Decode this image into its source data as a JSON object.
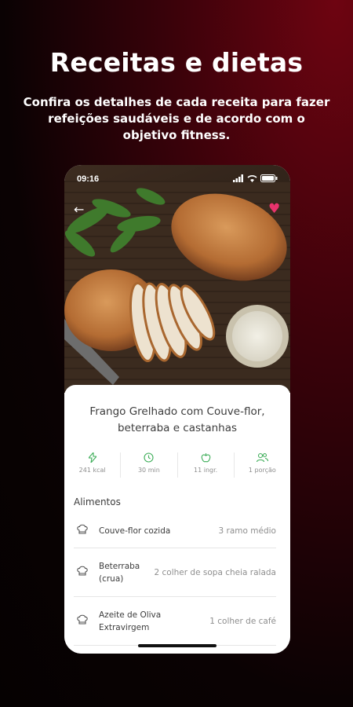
{
  "hero": {
    "title": "Receitas e dietas",
    "subtitle": "Confira os detalhes de cada receita para fazer refeições saudáveis e de acordo com o objetivo fitness."
  },
  "status_bar": {
    "time": "09:16",
    "icons": [
      "location-arrow-icon",
      "signal-icon",
      "wifi-icon",
      "battery-icon"
    ]
  },
  "recipe": {
    "title": "Frango Grelhado com Couve-flor, beterraba e castanhas",
    "stats": [
      {
        "icon": "lightning-icon",
        "value": "241 kcal"
      },
      {
        "icon": "clock-icon",
        "value": "30 min"
      },
      {
        "icon": "apple-icon",
        "value": "11 ingr."
      },
      {
        "icon": "people-icon",
        "value": "1 porção"
      }
    ],
    "section_title": "Alimentos",
    "foods": [
      {
        "name": "Couve-flor cozida",
        "quantity": "3 ramo médio"
      },
      {
        "name": "Beterraba (crua)",
        "quantity": "2 colher de sopa cheia ralada"
      },
      {
        "name": "Azeite de Oliva Extravirgem",
        "quantity": "1 colher de café"
      }
    ]
  },
  "colors": {
    "accent_green": "#3fae5a",
    "favorite_pink": "#e8336d",
    "background_red": "#6e0411"
  }
}
